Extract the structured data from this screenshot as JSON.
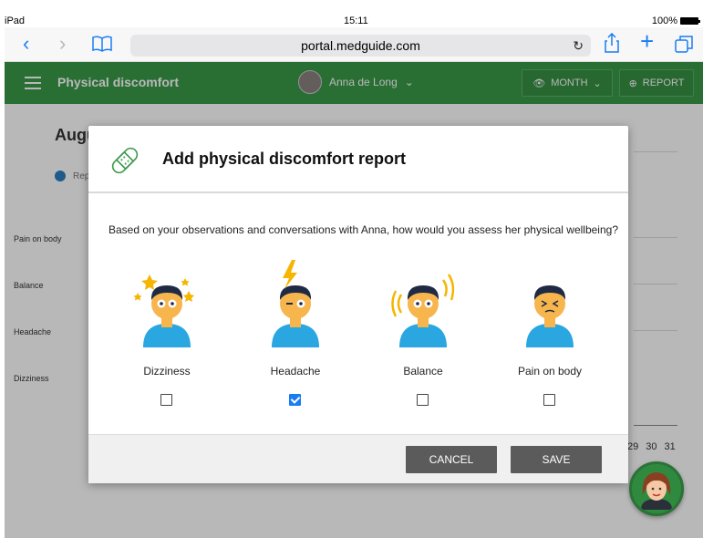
{
  "status_bar": {
    "carrier": "iPad",
    "time": "15:11",
    "battery": "100%"
  },
  "browser": {
    "url": "portal.medguide.com"
  },
  "app": {
    "title": "Physical discomfort",
    "user_name": "Anna de Long",
    "month_label": "MONTH",
    "report_label": "REPORT",
    "accent": "#3a9a49"
  },
  "background": {
    "title": "Augu",
    "legend": "Rep",
    "rows": [
      "Pain on body",
      "Balance",
      "Headache",
      "Dizziness"
    ],
    "days": [
      "29",
      "30",
      "31"
    ]
  },
  "modal": {
    "title": "Add physical discomfort report",
    "question": "Based on your observations and conversations with Anna, how would you assess her physical wellbeing?",
    "options": [
      {
        "label": "Dizziness",
        "checked": false,
        "icon": "dizziness-icon"
      },
      {
        "label": "Headache",
        "checked": true,
        "icon": "headache-icon"
      },
      {
        "label": "Balance",
        "checked": false,
        "icon": "balance-icon"
      },
      {
        "label": "Pain on body",
        "checked": false,
        "icon": "pain-icon"
      }
    ],
    "cancel_label": "CANCEL",
    "save_label": "SAVE"
  }
}
